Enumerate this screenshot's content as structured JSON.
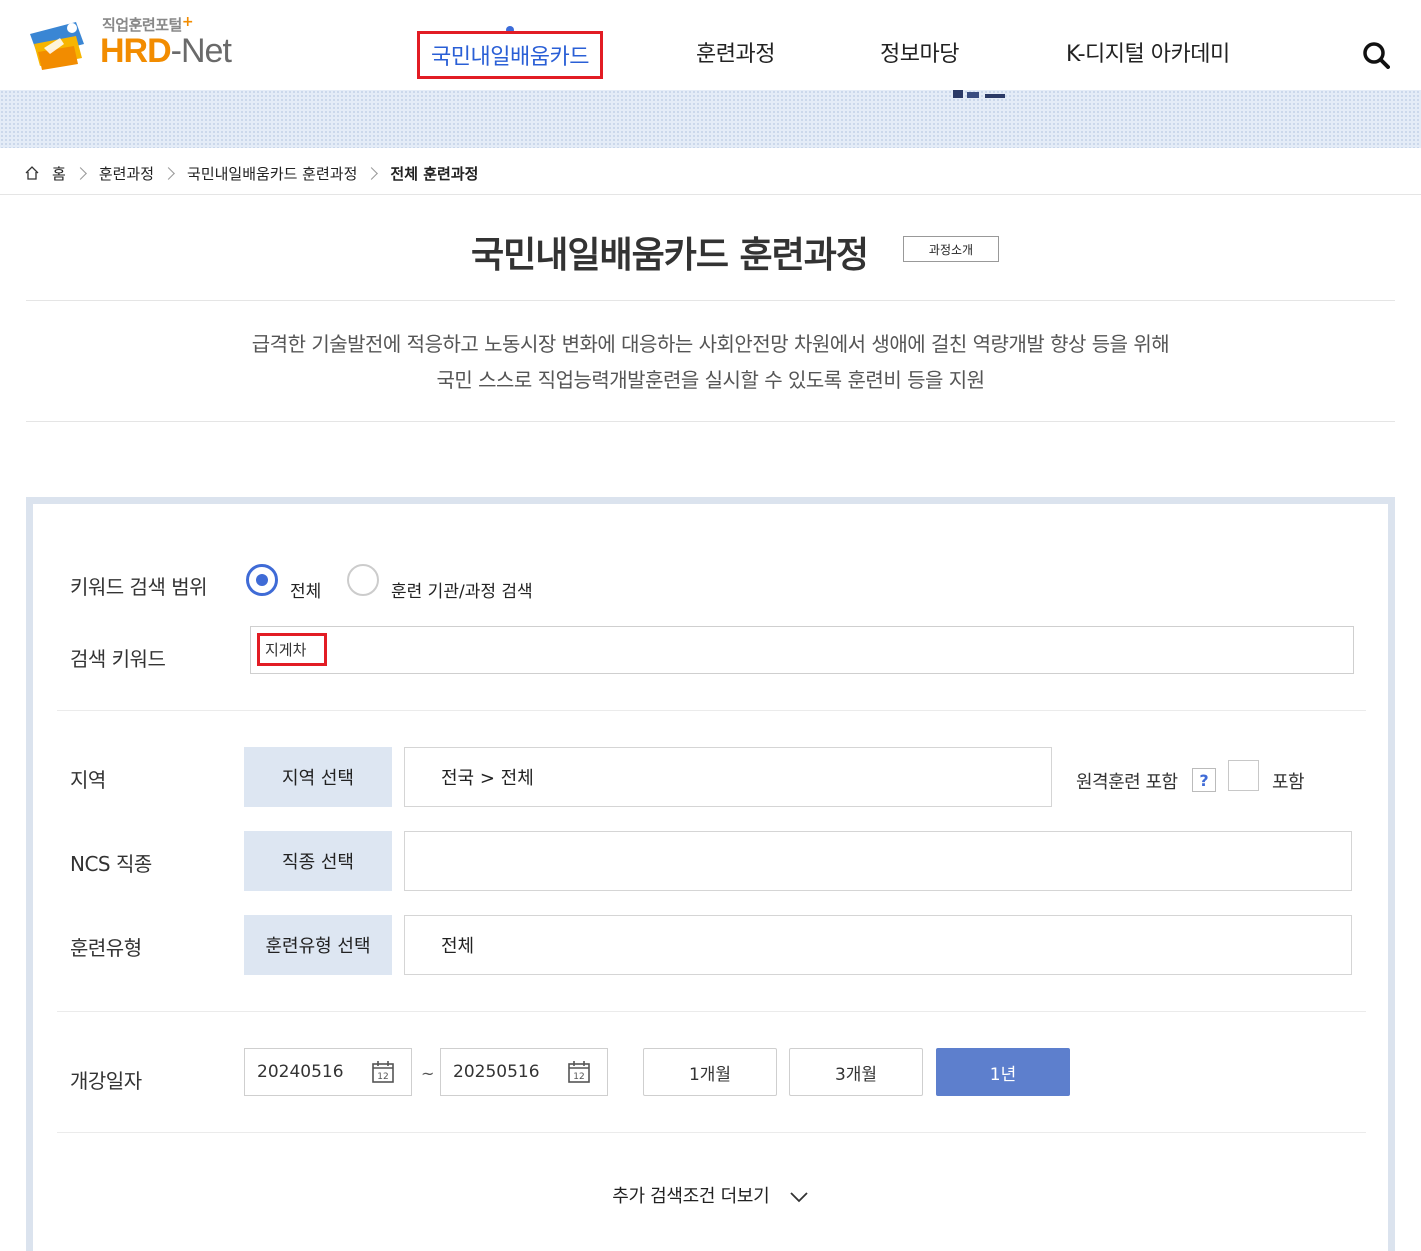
{
  "header": {
    "logo_sub": "직업훈련포털",
    "logo_plus": "+",
    "logo_hrd": "HRD",
    "logo_dash": "-",
    "logo_net": "Net",
    "nav": [
      "국민내일배움카드",
      "훈련과정",
      "정보마당",
      "K-디지털 아카데미"
    ],
    "search_icon": "search-icon"
  },
  "breadcrumb": {
    "home_icon": "home-icon",
    "items": [
      "홈",
      "훈련과정",
      "국민내일배움카드 훈련과정",
      "전체 훈련과정"
    ]
  },
  "title": {
    "text": "국민내일배움카드 훈련과정",
    "intro_button": "과정소개"
  },
  "description": {
    "line1": "급격한 기술발전에 적응하고 노동시장 변화에 대응하는 사회안전망 차원에서 생애에 걸친 역량개발 향상 등을 위해",
    "line2": "국민 스스로 직업능력개발훈련을 실시할 수 있도록 훈련비 등을 지원"
  },
  "search": {
    "scope_label": "키워드 검색 범위",
    "scope_options": [
      "전체",
      "훈련 기관/과정 검색"
    ],
    "scope_selected": "전체",
    "keyword_label": "검색 키워드",
    "keyword_value": "지게차",
    "region_label": "지역",
    "region_button": "지역 선택",
    "region_value": "전국 > 전체",
    "remote_label": "원격훈련 포함",
    "remote_help": "?",
    "remote_include": "포함",
    "remote_checked": false,
    "ncs_label": "NCS 직종",
    "ncs_button": "직종 선택",
    "ncs_value": "",
    "type_label": "훈련유형",
    "type_button": "훈련유형 선택",
    "type_value": "전체",
    "date_label": "개강일자",
    "date_from": "20240516",
    "date_sep": "~",
    "date_to": "20250516",
    "calendar_icon_text": "12",
    "periods": [
      "1개월",
      "3개월",
      "1년"
    ],
    "period_selected": "1년",
    "more_label": "추가 검색조건 더보기"
  },
  "colors": {
    "accent": "#3f6bd6",
    "highlight": "#e21c24",
    "select_button_bg": "#dde6f2",
    "active_period_bg": "#5d7fcd",
    "logo_orange": "#f28c00"
  }
}
